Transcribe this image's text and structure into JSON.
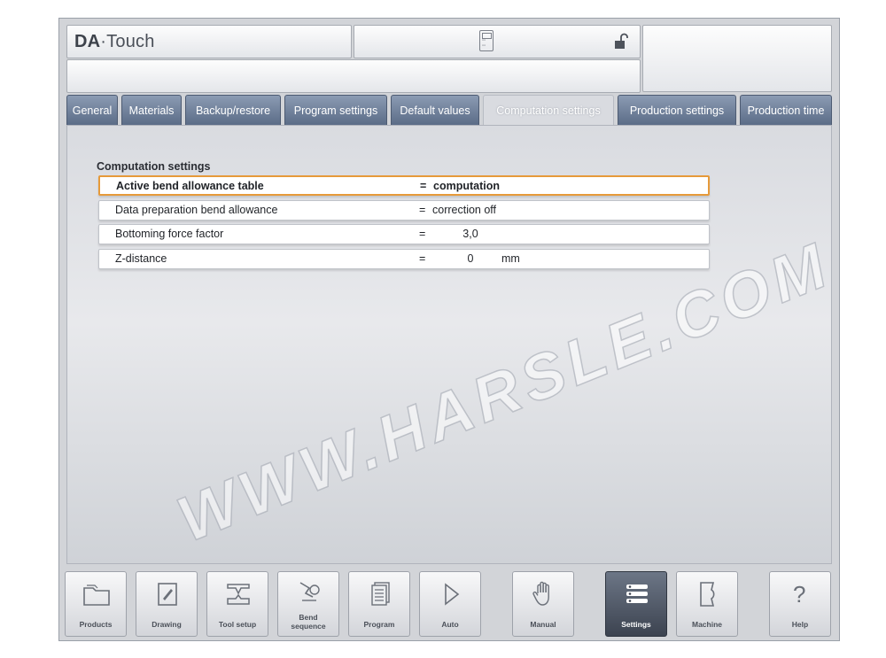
{
  "app": {
    "title_bold": "DA",
    "title_sep": "·",
    "title_rest": "Touch"
  },
  "tabs": [
    {
      "label": "General"
    },
    {
      "label": "Materials"
    },
    {
      "label": "Backup/restore"
    },
    {
      "label": "Program settings"
    },
    {
      "label": "Default values"
    },
    {
      "label": "Computation settings",
      "active": true
    },
    {
      "label": "Production settings"
    },
    {
      "label": "Production time"
    }
  ],
  "section": {
    "title": "Computation settings",
    "rows": [
      {
        "label": "Active bend allowance table",
        "eq": "=",
        "value": "computation",
        "selected": true
      },
      {
        "label": "Data preparation bend allowance",
        "eq": "=",
        "value": "correction off"
      },
      {
        "label": "Bottoming force factor",
        "eq": "=",
        "number": "3,0",
        "unit": ""
      },
      {
        "label": "Z-distance",
        "eq": "=",
        "number": "0",
        "unit": "mm"
      }
    ]
  },
  "watermark": "WWW.HARSLE.COM",
  "nav": [
    {
      "label": "Products",
      "icon": "folder-icon"
    },
    {
      "label": "Drawing",
      "icon": "drawing-icon"
    },
    {
      "label": "Tool setup",
      "icon": "tool-setup-icon"
    },
    {
      "label": "Bend sequence",
      "icon": "bend-sequence-icon"
    },
    {
      "label": "Program",
      "icon": "program-icon"
    },
    {
      "label": "Auto",
      "icon": "play-icon"
    },
    {
      "label": "Manual",
      "icon": "hand-icon"
    },
    {
      "label": "Settings",
      "icon": "settings-list-icon",
      "active": true
    },
    {
      "label": "Machine",
      "icon": "machine-icon"
    },
    {
      "label": "Help",
      "icon": "help-icon",
      "glyph": "?"
    }
  ],
  "colors": {
    "tab": "#5b6c87",
    "selected_border": "#e69a3a",
    "active_nav": "#3c4350"
  }
}
